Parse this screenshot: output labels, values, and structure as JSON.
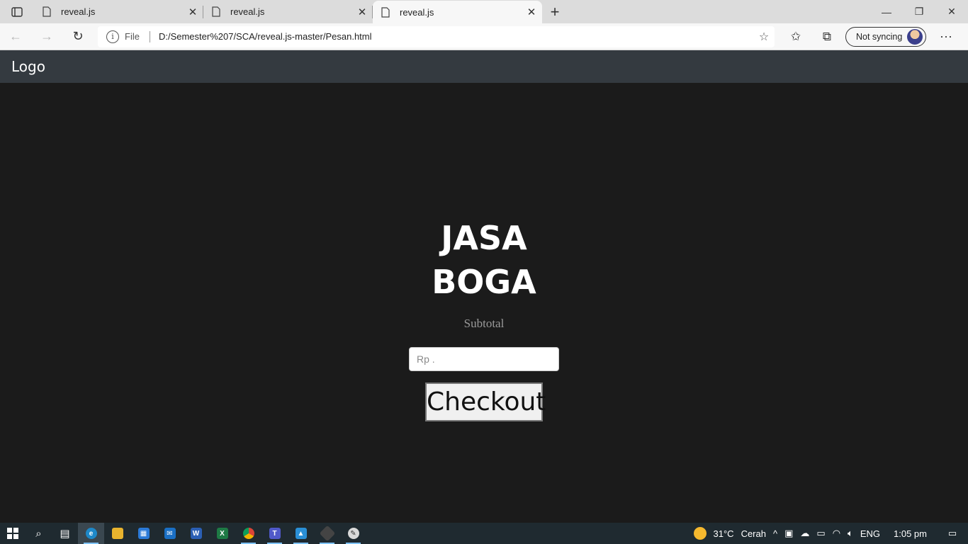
{
  "browser": {
    "tabs": [
      {
        "title": "reveal.js",
        "active": false
      },
      {
        "title": "reveal.js",
        "active": false
      },
      {
        "title": "reveal.js",
        "active": true
      }
    ],
    "address": {
      "scheme": "File",
      "url": "D:/Semester%207/SCA/reveal.js-master/Pesan.html"
    },
    "profile_label": "Not syncing"
  },
  "page": {
    "logo": "Logo",
    "heading_line1": "JASA",
    "heading_line2": "BOGA",
    "subtotal_label": "Subtotal",
    "amount_placeholder": "Rp .",
    "checkout_label": "Checkout"
  },
  "taskbar": {
    "apps": [
      "edge",
      "file-explorer",
      "microsoft-store",
      "mail",
      "word",
      "excel",
      "chrome",
      "teams",
      "photos",
      "git",
      "paint"
    ],
    "weather_temp": "31°C",
    "weather_desc": "Cerah",
    "language": "ENG",
    "time": "1:05 pm"
  },
  "colors": {
    "page_bg": "#1b1b1b",
    "navbar_bg": "#343a40",
    "taskbar_bg": "#1f2a30"
  }
}
